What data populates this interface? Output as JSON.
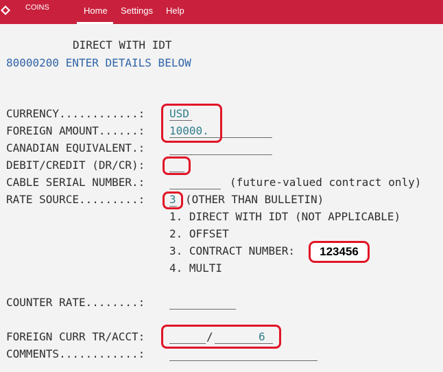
{
  "app": {
    "brand": "COINS"
  },
  "nav": {
    "home": "Home",
    "settings": "Settings",
    "help": "Help"
  },
  "screen": {
    "title": "DIRECT WITH IDT",
    "message": "80000200 ENTER DETAILS BELOW"
  },
  "fields": {
    "currency_label": "CURRENCY............:",
    "currency_value": "USD",
    "foreign_amount_label": "FOREIGN AMOUNT......:",
    "foreign_amount_value": "10000.",
    "canadian_equivalent_label": "CANADIAN EQUIVALENT.:",
    "debit_credit_label": "DEBIT/CREDIT (DR/CR):",
    "cable_serial_label": "CABLE SERIAL NUMBER.:",
    "cable_serial_note": "(future-valued contract only)",
    "rate_source_label": "RATE SOURCE.........:",
    "rate_source_value": "3",
    "rate_source_note": "(OTHER THAN BULLETIN)",
    "options": [
      "1. DIRECT WITH IDT (NOT APPLICABLE)",
      "2. OFFSET",
      "3. CONTRACT NUMBER:",
      "4. MULTI"
    ],
    "contract_number": "123456",
    "counter_rate_label": "COUNTER RATE........:",
    "foreign_curr_label": "FOREIGN CURR TR/ACCT:",
    "foreign_curr_separator": "/",
    "foreign_curr_acct_value": "6",
    "comments_label": "COMMENTS............:"
  },
  "colors": {
    "header": "#c9213d",
    "highlight": "#e11426",
    "message": "#2f64a8",
    "input_text": "#2f7d8c"
  }
}
